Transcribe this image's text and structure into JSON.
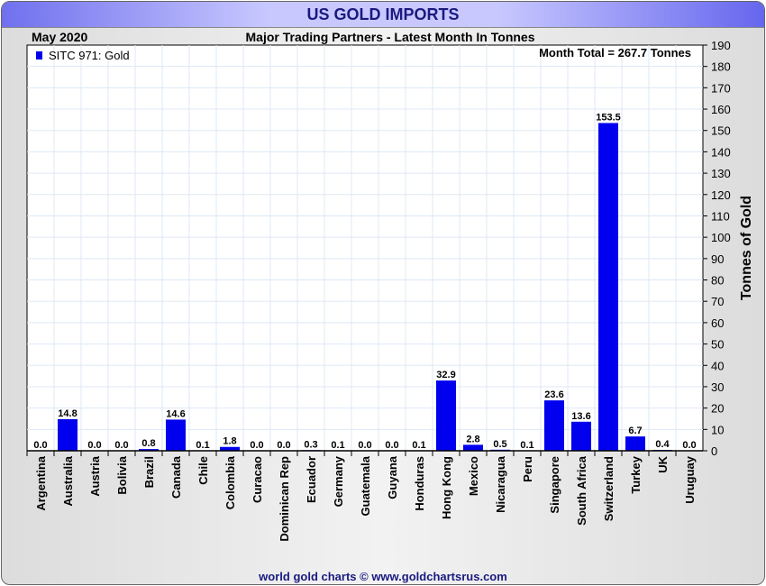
{
  "header": {
    "title": "US GOLD IMPORTS",
    "date": "May 2020",
    "subtitle": "Major Trading Partners - Latest Month In Tonnes",
    "footer": "world gold charts © www.goldchartsrus.com"
  },
  "chart_data": {
    "type": "bar",
    "title": "US GOLD IMPORTS",
    "subtitle": "Major Trading Partners - Latest Month In Tonnes",
    "ylabel": "Tonnes of Gold",
    "ylim": [
      0,
      190
    ],
    "yticks": [
      0,
      10,
      20,
      30,
      40,
      50,
      60,
      70,
      80,
      90,
      100,
      110,
      120,
      130,
      140,
      150,
      160,
      170,
      180,
      190
    ],
    "legend": {
      "label": "SITC 971: Gold",
      "position": "top-left"
    },
    "annotation": "Month Total = 267.7 Tonnes",
    "grid": true,
    "color": "#0000ee",
    "categories": [
      "Argentina",
      "Australia",
      "Austria",
      "Bolivia",
      "Brazil",
      "Canada",
      "Chile",
      "Colombia",
      "Curacao",
      "Dominican Rep",
      "Ecuador",
      "Germany",
      "Guatemala",
      "Guyana",
      "Honduras",
      "Hong Kong",
      "Mexico",
      "Nicaragua",
      "Peru",
      "Singapore",
      "South Africa",
      "Switzerland",
      "Turkey",
      "UK",
      "Uruguay"
    ],
    "values": [
      0.0,
      14.8,
      0.0,
      0.0,
      0.8,
      14.6,
      0.1,
      1.8,
      0.0,
      0.0,
      0.3,
      0.1,
      0.0,
      0.0,
      0.1,
      32.9,
      2.8,
      0.5,
      0.1,
      23.6,
      13.6,
      153.5,
      6.7,
      0.4,
      0.0
    ]
  }
}
